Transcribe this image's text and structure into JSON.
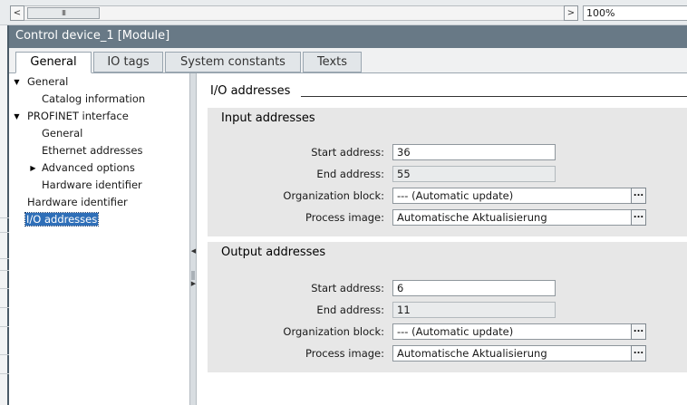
{
  "toolbar": {
    "scroll_left_glyph": "<",
    "scroll_thumb_glyph": "III",
    "scroll_right_glyph": ">",
    "zoom": "100%"
  },
  "window": {
    "title": "Control device_1 [Module]"
  },
  "tabs": [
    {
      "label": "General",
      "active": true
    },
    {
      "label": "IO tags",
      "active": false
    },
    {
      "label": "System constants",
      "active": false
    },
    {
      "label": "Texts",
      "active": false
    }
  ],
  "tree": {
    "items": [
      {
        "label": "General",
        "expanded": true
      },
      {
        "label": "Catalog information"
      },
      {
        "label": "PROFINET interface",
        "expanded": true
      },
      {
        "label": "General"
      },
      {
        "label": "Ethernet addresses"
      },
      {
        "label": "Advanced options",
        "expanded": false
      },
      {
        "label": "Hardware identifier"
      },
      {
        "label": "Hardware identifier"
      },
      {
        "label": "I/O addresses",
        "selected": true
      }
    ]
  },
  "section": {
    "title": "I/O addresses"
  },
  "input_addresses": {
    "title": "Input addresses",
    "start_label": "Start address:",
    "start_value": "36",
    "end_label": "End address:",
    "end_value": "55",
    "ob_label": "Organization block:",
    "ob_value": "--- (Automatic update)",
    "pi_label": "Process image:",
    "pi_value": "Automatische Aktualisierung"
  },
  "output_addresses": {
    "title": "Output addresses",
    "start_label": "Start address:",
    "start_value": "6",
    "end_label": "End address:",
    "end_value": "11",
    "ob_label": "Organization block:",
    "ob_value": "--- (Automatic update)",
    "pi_label": "Process image:",
    "pi_value": "Automatische Aktualisierung"
  },
  "browse_glyph": "...",
  "splitter": {
    "collapse_glyph": "◀",
    "expand_glyph": "▶"
  },
  "colors": {
    "titlebar": "#687986",
    "selection": "#2f6fb8",
    "panel": "#e7e7e7"
  }
}
